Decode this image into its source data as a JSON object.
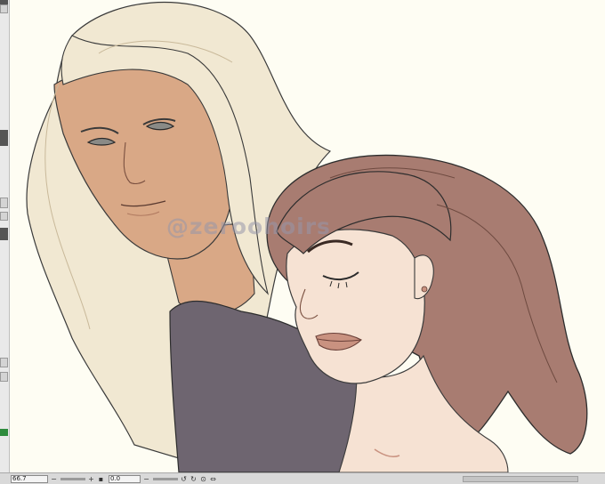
{
  "app": {
    "watermark": "@zeroohoirs"
  },
  "statusbar": {
    "zoom_value": "66.7",
    "rotate_value": "0.0",
    "zoom_out_icon": "minus-icon",
    "zoom_in_icon": "plus-icon",
    "rotate_left_icon": "rotate-left-icon",
    "rotate_right_icon": "rotate-right-icon",
    "reset_icon": "reset-rotation-icon",
    "flip_icon": "flip-icon"
  },
  "colors": {
    "background": "#fefdf3",
    "blonde_hair": "#f1e8d2",
    "tan_skin": "#d9a886",
    "fair_skin": "#f6e2d3",
    "brown_hair": "#a87c71",
    "gray_shirt": "#6e6570",
    "lip_color": "#c99280"
  }
}
